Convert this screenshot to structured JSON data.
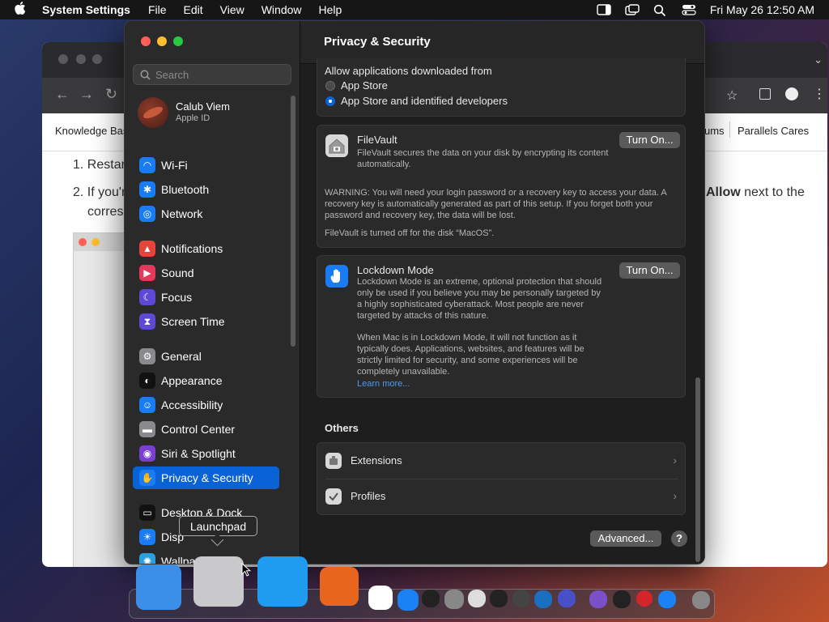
{
  "menubar": {
    "app_name": "System Settings",
    "menus": [
      "File",
      "Edit",
      "View",
      "Window",
      "Help"
    ],
    "datetime": "Fri May 26  12:50 AM"
  },
  "background_browser": {
    "links": {
      "left": "Knowledge Bas",
      "mid": "ums",
      "right": "Parallels Cares"
    },
    "content": {
      "line1": "1. Restar",
      "line2": "2. If you'r",
      "line3": "corres",
      "allow_bold": "Allow",
      "allow_rest": " next to the"
    }
  },
  "sidebar": {
    "search_placeholder": "Search",
    "user": {
      "name": "Calub Viem",
      "sub": "Apple ID"
    },
    "items": [
      {
        "label": "Wi-Fi",
        "icon": "wifi-icon",
        "color": "#1a7cf5"
      },
      {
        "label": "Bluetooth",
        "icon": "bluetooth-icon",
        "color": "#1a7cf5"
      },
      {
        "label": "Network",
        "icon": "globe-icon",
        "color": "#1a7cf5"
      },
      {
        "label": "Notifications",
        "icon": "bell-icon",
        "color": "#e5443a"
      },
      {
        "label": "Sound",
        "icon": "speaker-icon",
        "color": "#e5385b"
      },
      {
        "label": "Focus",
        "icon": "moon-icon",
        "color": "#5c4ad6"
      },
      {
        "label": "Screen Time",
        "icon": "hourglass-icon",
        "color": "#5c4ad6"
      },
      {
        "label": "General",
        "icon": "gear-icon",
        "color": "#8a8a8e"
      },
      {
        "label": "Appearance",
        "icon": "appearance-icon",
        "color": "#111111"
      },
      {
        "label": "Accessibility",
        "icon": "accessibility-icon",
        "color": "#1a7cf5"
      },
      {
        "label": "Control Center",
        "icon": "control-center-icon",
        "color": "#8a8a8e"
      },
      {
        "label": "Siri & Spotlight",
        "icon": "siri-icon",
        "color": "#7a3fd0"
      },
      {
        "label": "Privacy & Security",
        "icon": "hand-icon",
        "color": "#1a7cf5",
        "selected": true
      },
      {
        "label": "Desktop & Dock",
        "icon": "desktop-icon",
        "color": "#111111"
      },
      {
        "label": "Disp",
        "icon": "display-icon",
        "color": "#1a7cf5"
      },
      {
        "label": "Wallpaper",
        "icon": "wallpaper-icon",
        "color": "#2aa0e0"
      }
    ]
  },
  "main": {
    "title": "Privacy & Security",
    "allow_downloads": {
      "label": "Allow applications downloaded from",
      "options": [
        "App Store",
        "App Store and identified developers"
      ],
      "selected_index": 1
    },
    "filevault": {
      "title": "FileVault",
      "desc": "FileVault secures the data on your disk by encrypting its content automatically.",
      "button": "Turn On...",
      "warning": "WARNING: You will need your login password or a recovery key to access your data. A recovery key is automatically generated as part of this setup. If you forget both your password and recovery key, the data will be lost.",
      "status": "FileVault is turned off for the disk “MacOS”."
    },
    "lockdown": {
      "title": "Lockdown Mode",
      "desc": "Lockdown Mode is an extreme, optional protection that should only be used if you believe you may be personally targeted by a highly sophisticated cyberattack. Most people are never targeted by attacks of this nature.",
      "desc2": "When Mac is in Lockdown Mode, it will not function as it typically does. Applications, websites, and features will be strictly limited for security, and some experiences will be completely unavailable.",
      "link": "Learn more...",
      "button": "Turn On..."
    },
    "others": {
      "heading": "Others",
      "rows": [
        {
          "label": "Extensions",
          "icon": "extensions-icon"
        },
        {
          "label": "Profiles",
          "icon": "profiles-icon"
        }
      ]
    },
    "advanced_button": "Advanced...",
    "help_button": "?"
  },
  "tooltip": "Launchpad",
  "dock": {
    "apps": [
      "finder-icon",
      "launchpad-icon",
      "safari-icon",
      "firefox-icon",
      "chrome-icon",
      "app-store-icon",
      "terminal-icon",
      "system-settings-icon",
      "script-editor-icon",
      "terminal-2-icon",
      "automator-icon",
      "vscode-icon",
      "parallels-icon",
      "visual-studio-icon",
      "activity-monitor-icon",
      "parallels-desktop-icon",
      "windows-icon",
      "trash-icon"
    ]
  },
  "colors": {
    "accent": "#0a63d6",
    "close": "#ff5f57",
    "minimize": "#febc2e",
    "zoom": "#28c840"
  }
}
